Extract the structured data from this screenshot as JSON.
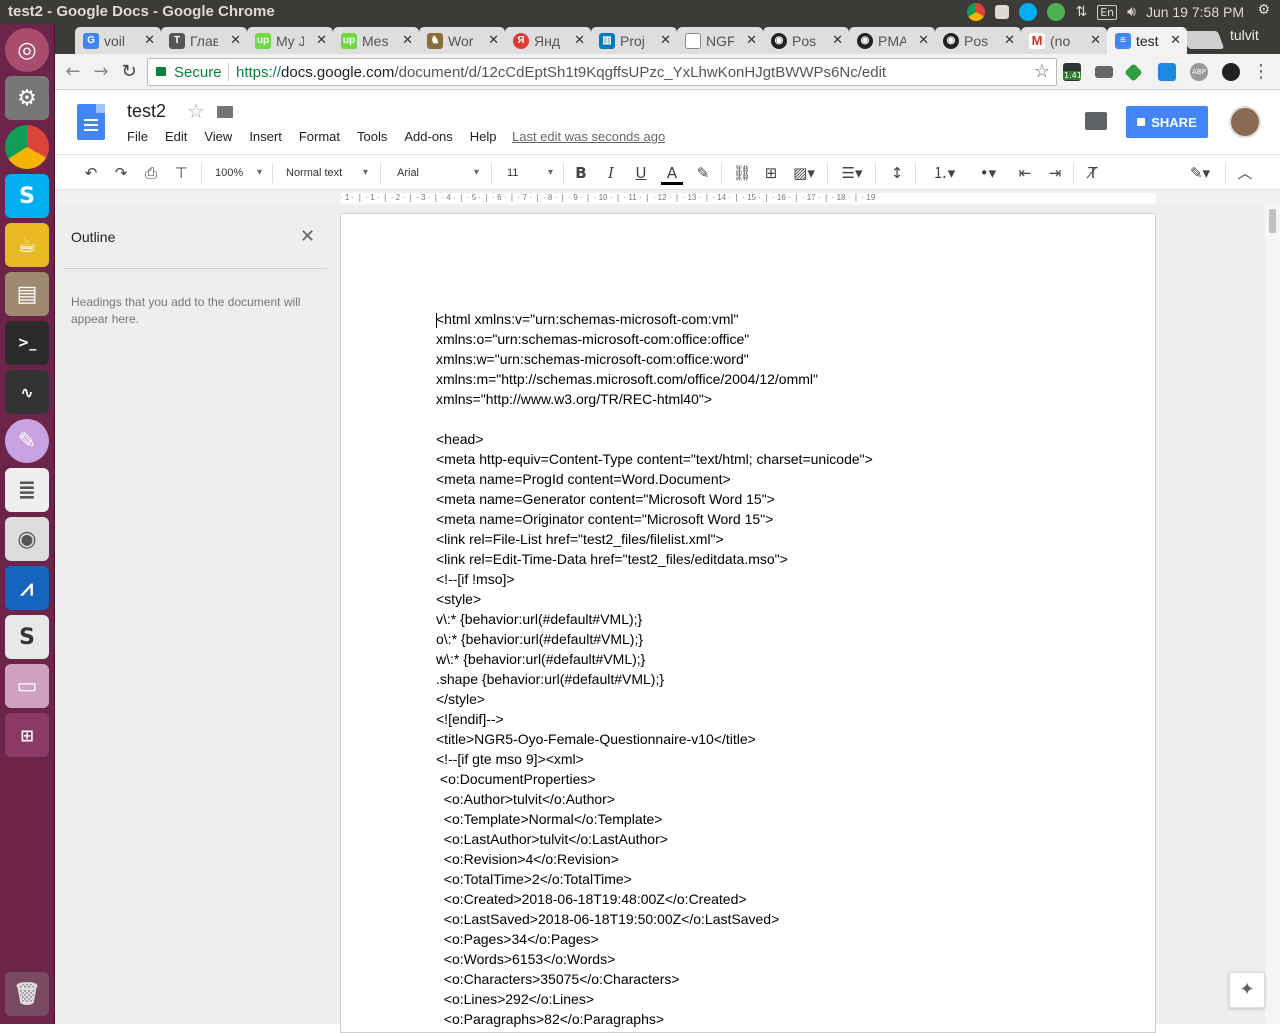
{
  "system": {
    "window_title": "test2 - Google Docs - Google Chrome",
    "lang": "En",
    "clock": "Jun 19  7:58 PM"
  },
  "tabs": [
    {
      "label": "voil",
      "icon": "google-icon",
      "color": "#4285f4"
    },
    {
      "label": "Глав",
      "icon": "times-icon",
      "color": "#555555"
    },
    {
      "label": "My J",
      "icon": "upwork-icon",
      "color": "#6fda44"
    },
    {
      "label": "Mes",
      "icon": "upwork-icon",
      "color": "#6fda44"
    },
    {
      "label": "Wor",
      "icon": "woo-icon",
      "color": "#8a6d3b"
    },
    {
      "label": "Янд",
      "icon": "yandex-icon",
      "color": "#e53935"
    },
    {
      "label": "Proj",
      "icon": "trello-icon",
      "color": "#0079bf"
    },
    {
      "label": "NGF",
      "icon": "file-icon",
      "color": "#888888"
    },
    {
      "label": "Pos",
      "icon": "github-icon",
      "color": "#222222"
    },
    {
      "label": "PMA",
      "icon": "github-icon",
      "color": "#222222"
    },
    {
      "label": "Pos",
      "icon": "github-icon",
      "color": "#222222"
    },
    {
      "label": "(no",
      "icon": "gmail-icon",
      "color": "#d93025"
    },
    {
      "label": "test",
      "icon": "docs-icon",
      "color": "#4285f4"
    }
  ],
  "profile_name": "tulvit",
  "omnibox": {
    "secure_label": "Secure",
    "url_scheme": "https://",
    "url_host": "docs.google.com",
    "url_path": "/document/d/12cCdEptSh1t9KqgffsUPzc_YxLhwKonHJgtBWWPs6Nc/edit"
  },
  "extensions": {
    "badge": "1.41"
  },
  "docs": {
    "title": "test2",
    "menu": [
      "File",
      "Edit",
      "View",
      "Insert",
      "Format",
      "Tools",
      "Add-ons",
      "Help"
    ],
    "last_edit": "Last edit was seconds ago",
    "share_label": "SHARE"
  },
  "toolbar": {
    "zoom": "100%",
    "style": "Normal text",
    "font": "Arial",
    "size": "11"
  },
  "ruler_text": "· 1 · ❘ · 1 · ❘ · 2 · ❘ · 3 · ❘ · 4 · ❘ · 5 · ❘ · 6 · ❘ · 7 · ❘ · 8 · ❘ · 9 · ❘ · 10 · ❘ · 11 · ❘ · 12 · ❘ · 13 · ❘ · 14 · ❘ · 15 · ❘ · 16 · ❘ · 17 · ❘ · 18 · ❘ · 19",
  "outline": {
    "title": "Outline",
    "hint": "Headings that you add to the document will appear here."
  },
  "document_lines": [
    "<html xmlns:v=\"urn:schemas-microsoft-com:vml\"",
    "xmlns:o=\"urn:schemas-microsoft-com:office:office\"",
    "xmlns:w=\"urn:schemas-microsoft-com:office:word\"",
    "xmlns:m=\"http://schemas.microsoft.com/office/2004/12/omml\"",
    "xmlns=\"http://www.w3.org/TR/REC-html40\">",
    "",
    "<head>",
    "<meta http-equiv=Content-Type content=\"text/html; charset=unicode\">",
    "<meta name=ProgId content=Word.Document>",
    "<meta name=Generator content=\"Microsoft Word 15\">",
    "<meta name=Originator content=\"Microsoft Word 15\">",
    "<link rel=File-List href=\"test2_files/filelist.xml\">",
    "<link rel=Edit-Time-Data href=\"test2_files/editdata.mso\">",
    "<!--[if !mso]>",
    "<style>",
    "v\\:* {behavior:url(#default#VML);}",
    "o\\:* {behavior:url(#default#VML);}",
    "w\\:* {behavior:url(#default#VML);}",
    ".shape {behavior:url(#default#VML);}",
    "</style>",
    "<![endif]-->",
    "<title>NGR5-Oyo-Female-Questionnaire-v10</title>",
    "<!--[if gte mso 9]><xml>",
    " <o:DocumentProperties>",
    "  <o:Author>tulvit</o:Author>",
    "  <o:Template>Normal</o:Template>",
    "  <o:LastAuthor>tulvit</o:LastAuthor>",
    "  <o:Revision>4</o:Revision>",
    "  <o:TotalTime>2</o:TotalTime>",
    "  <o:Created>2018-06-18T19:48:00Z</o:Created>",
    "  <o:LastSaved>2018-06-18T19:50:00Z</o:LastSaved>",
    "  <o:Pages>34</o:Pages>",
    "  <o:Words>6153</o:Words>",
    "  <o:Characters>35075</o:Characters>",
    "  <o:Lines>292</o:Lines>",
    "  <o:Paragraphs>82</o:Paragraphs>"
  ]
}
